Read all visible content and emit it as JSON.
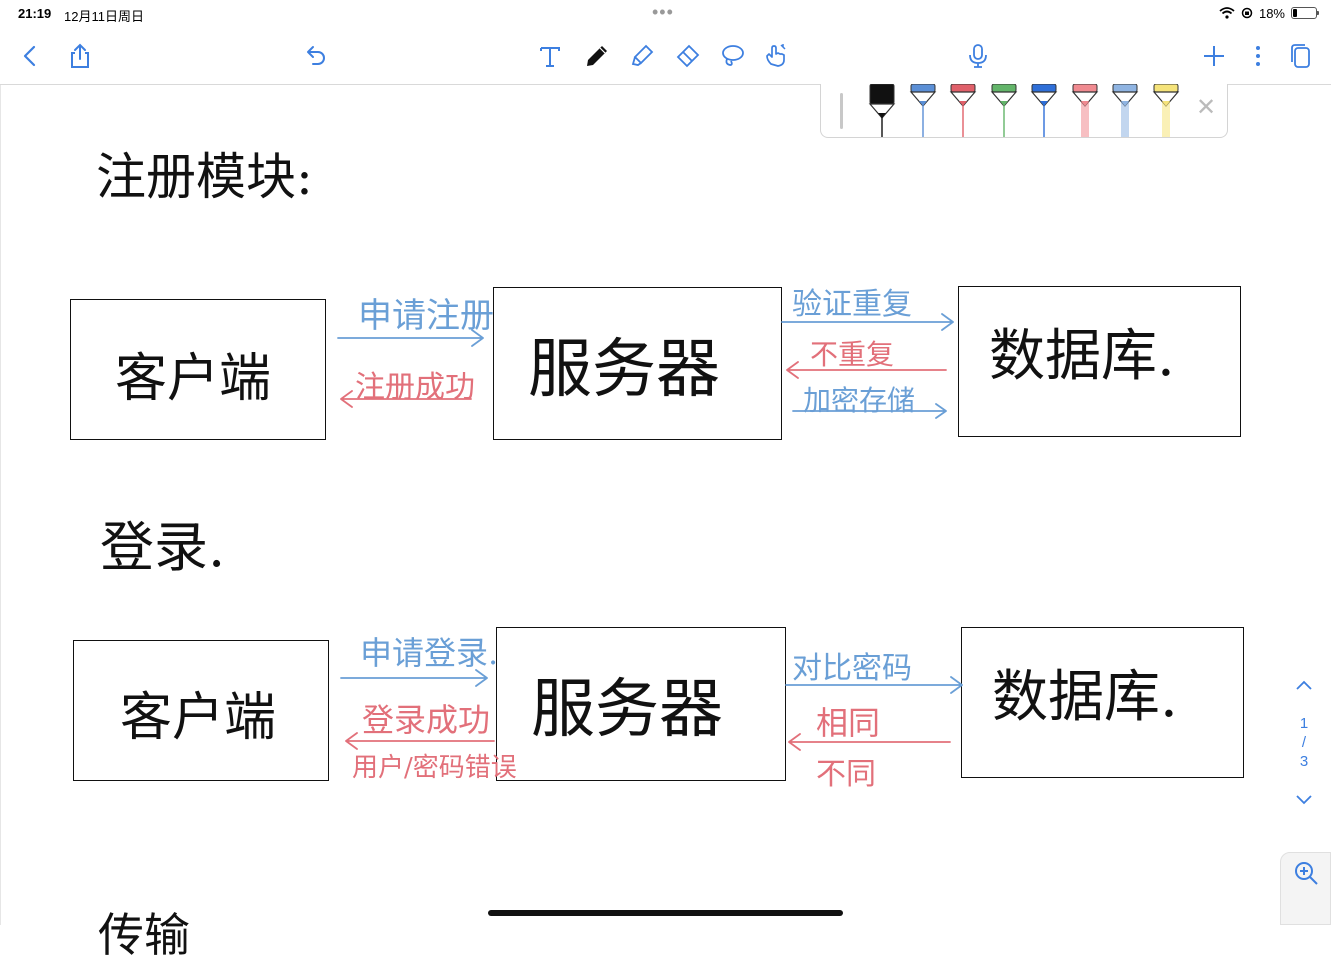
{
  "status_bar": {
    "time": "21:19",
    "date": "12月11日周日",
    "battery_percent": "18%",
    "battery_level": 0.18
  },
  "toolbar": {
    "left_icons": [
      "back-chevron-icon",
      "share-icon",
      "undo-icon"
    ],
    "center_tools": [
      "text-tool-icon",
      "pen-tool-icon",
      "highlighter-tool-icon",
      "eraser-tool-icon",
      "lasso-tool-icon",
      "hand-gesture-icon"
    ],
    "right_icons": [
      "microphone-icon",
      "add-icon",
      "more-vertical-icon",
      "pages-icon"
    ],
    "accent_color": "#3d7fe0"
  },
  "pen_palette": {
    "colors": [
      "#111111",
      "#5b8fd6",
      "#e0606a",
      "#63b56a",
      "#2f6fd8",
      "#f08a90",
      "#8fb4e2",
      "#f5e37a"
    ],
    "selected_index": 0
  },
  "note": {
    "section1_title": "注册模块:",
    "section2_title": "登录.",
    "section3_title": "传输",
    "register": {
      "client": "客户端",
      "server": "服务器",
      "database": "数据库.",
      "client_to_server": "申请注册",
      "server_to_client": "注册成功",
      "server_to_db": "验证重复",
      "db_to_server": "不重复",
      "server_to_db_store": "加密存储"
    },
    "login": {
      "client": "客户端",
      "server": "服务器",
      "database": "数据库.",
      "client_to_server": "申请登录.",
      "server_to_client_ok": "登录成功",
      "server_to_client_err": "用户/密码错误",
      "server_to_db": "对比密码",
      "db_to_server_same": "相同",
      "db_to_server_diff": "不同"
    }
  },
  "pager": {
    "current": "1",
    "separator": "/",
    "total": "3"
  }
}
